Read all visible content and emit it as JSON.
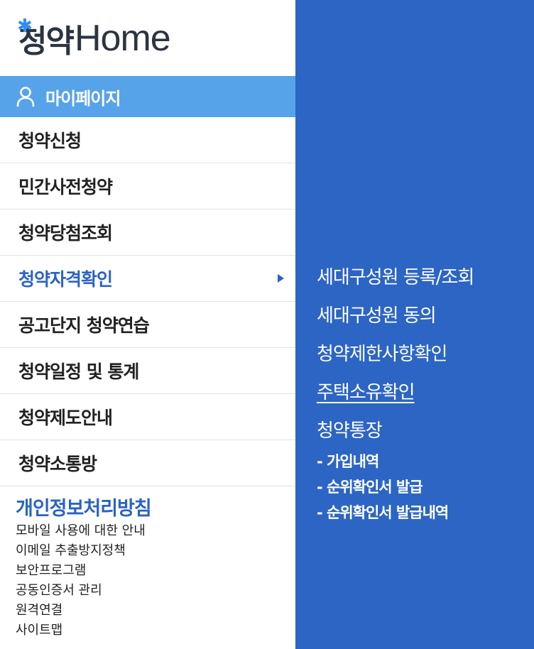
{
  "logo": {
    "korean": "청약",
    "english": "Home",
    "star_color": "#2f8ff0"
  },
  "mypage": {
    "label": "마이페이지",
    "icon": "person-icon",
    "bg_color": "#57a3e9"
  },
  "nav": {
    "items": [
      {
        "label": "청약신청"
      },
      {
        "label": "민간사전청약"
      },
      {
        "label": "청약당첨조회"
      },
      {
        "label": "청약자격확인",
        "active": true
      },
      {
        "label": "공고단지 청약연습"
      },
      {
        "label": "청약일정 및 통계"
      },
      {
        "label": "청약제도안내"
      },
      {
        "label": "청약소통방"
      }
    ],
    "active_color": "#2a63c2"
  },
  "footer": {
    "title": "개인정보처리방침",
    "links": [
      "모바일 사용에 대한 안내",
      "이메일 추출방지정책",
      "보안프로그램",
      "공동인증서 관리",
      "원격연결",
      "사이트맵"
    ]
  },
  "submenu": {
    "bg_color": "#2c65c4",
    "items": [
      {
        "label": "세대구성원 등록/조회"
      },
      {
        "label": "세대구성원 동의"
      },
      {
        "label": "청약제한사항확인"
      },
      {
        "label": "주택소유확인",
        "underlined": true
      },
      {
        "label": "청약통장"
      }
    ],
    "subitems": [
      "- 가입내역",
      "- 순위확인서 발급",
      "- 순위확인서 발급내역"
    ]
  }
}
